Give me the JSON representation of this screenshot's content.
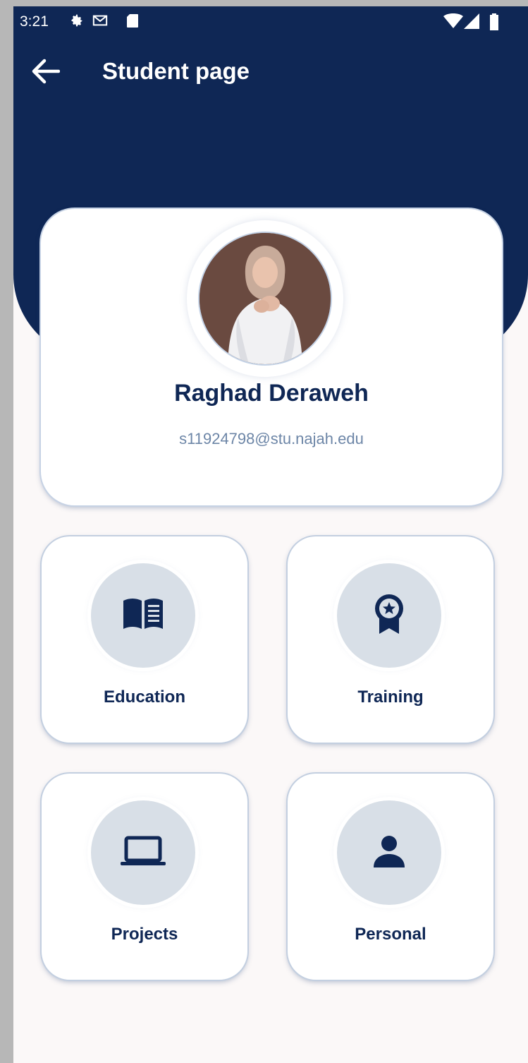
{
  "status_bar": {
    "time": "3:21",
    "icons": [
      "settings-icon",
      "gmail-icon",
      "sd-card-icon",
      "wifi-icon",
      "signal-icon",
      "battery-icon"
    ]
  },
  "header": {
    "title": "Student page",
    "back_icon": "arrow-back-icon"
  },
  "profile": {
    "name": "Raghad Deraweh",
    "email": "s11924798@stu.najah.edu"
  },
  "menu": [
    {
      "label": "Education",
      "icon": "book-icon"
    },
    {
      "label": "Training",
      "icon": "award-icon"
    },
    {
      "label": "Projects",
      "icon": "laptop-icon"
    },
    {
      "label": "Personal",
      "icon": "person-icon"
    }
  ],
  "colors": {
    "primary": "#0f2755",
    "background": "#fbf8f8",
    "icon_circle": "#d8dfe7",
    "email_text": "#6d86a7"
  }
}
